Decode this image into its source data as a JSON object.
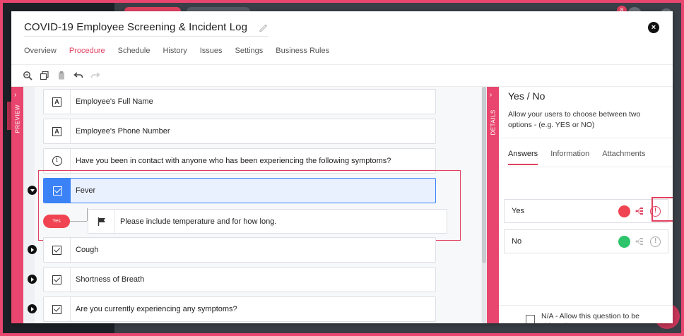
{
  "background": {
    "notification_count": "8"
  },
  "modal": {
    "title": "COVID-19 Employee Screening & Incident Log",
    "close_label": "×"
  },
  "tabs": [
    {
      "label": "Overview",
      "active": false
    },
    {
      "label": "Procedure",
      "active": true
    },
    {
      "label": "Schedule",
      "active": false
    },
    {
      "label": "History",
      "active": false
    },
    {
      "label": "Issues",
      "active": false
    },
    {
      "label": "Settings",
      "active": false
    },
    {
      "label": "Business Rules",
      "active": false
    }
  ],
  "toolbar": {
    "icons": [
      "zoom-icon",
      "copy-icon",
      "paste-icon",
      "undo-icon",
      "redo-icon"
    ]
  },
  "preview_strip": {
    "label": "PREVIEW",
    "chevron": "›"
  },
  "details_strip": {
    "label": "DETAILS",
    "chevron": "›"
  },
  "questions": [
    {
      "icon": "text-field-icon",
      "icon_glyph": "A",
      "text": "Employee's Full Name"
    },
    {
      "icon": "text-field-icon",
      "icon_glyph": "A",
      "text": "Employee's Phone Number"
    },
    {
      "icon": "info-icon",
      "icon_glyph": "i",
      "text": "Have you been in contact with anyone who has been experiencing the following symptoms?"
    },
    {
      "icon": "checkbox-icon",
      "text": "Fever",
      "selected": true,
      "expanded": true
    },
    {
      "icon": "checkbox-icon",
      "text": "Cough",
      "expanded": false
    },
    {
      "icon": "checkbox-icon",
      "text": "Shortness of Breath",
      "expanded": false
    },
    {
      "icon": "checkbox-icon",
      "text": "Are you currently experiencing any symptoms?",
      "expanded": false
    }
  ],
  "logic": {
    "pill_label": "Yes",
    "pill_color": "#f04452",
    "sub_text": "Please include temperature and for how long."
  },
  "details": {
    "title": "Yes / No",
    "description": "Allow your users to choose between two options - (e.g. YES or NO)",
    "tabs": [
      {
        "label": "Answers",
        "active": true
      },
      {
        "label": "Information",
        "active": false
      },
      {
        "label": "Attachments",
        "active": false
      }
    ],
    "answers": [
      {
        "label": "Yes",
        "color": "#f04452",
        "warn": "!"
      },
      {
        "label": "No",
        "color": "#2ec46b",
        "warn": "!"
      }
    ],
    "na_text": "N/A - Allow this question to be skipped"
  },
  "colors": {
    "accent": "#e0405f",
    "selected_blue": "#3b82f6"
  }
}
